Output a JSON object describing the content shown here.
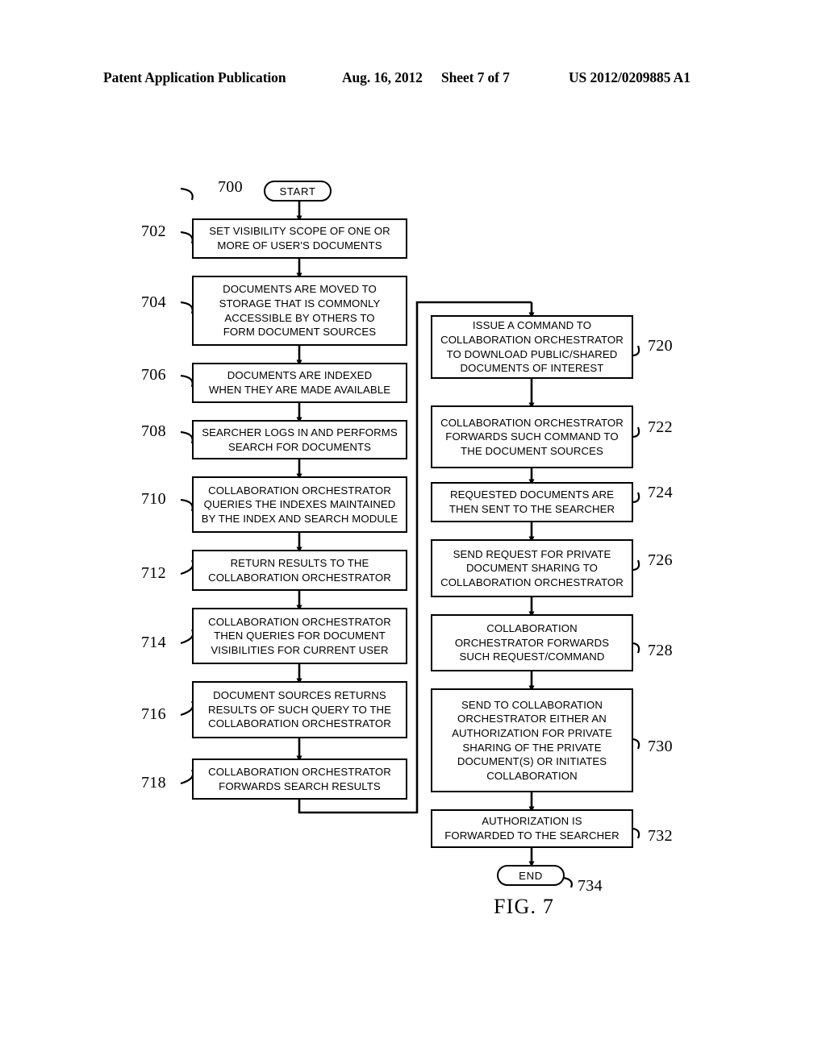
{
  "header": {
    "publication": "Patent Application Publication",
    "date": "Aug. 16, 2012",
    "sheet": "Sheet 7 of 7",
    "patent_number": "US 2012/0209885 A1"
  },
  "figure": {
    "caption": "FIG. 7",
    "diagram_type": "flowchart",
    "line_color": "#000000",
    "background_color": "#ffffff"
  },
  "flowchart": {
    "start": {
      "ref": "700",
      "label": "START"
    },
    "end": {
      "ref": "734",
      "label": "END"
    },
    "left_column": [
      {
        "ref": "702",
        "text": "SET VISIBILITY SCOPE OF ONE OR\nMORE OF USER'S DOCUMENTS"
      },
      {
        "ref": "704",
        "text": "DOCUMENTS ARE MOVED TO\nSTORAGE THAT IS COMMONLY\nACCESSIBLE BY OTHERS TO\nFORM DOCUMENT SOURCES"
      },
      {
        "ref": "706",
        "text": "DOCUMENTS ARE INDEXED\nWHEN THEY ARE MADE AVAILABLE"
      },
      {
        "ref": "708",
        "text": "SEARCHER LOGS IN AND PERFORMS\nSEARCH FOR DOCUMENTS"
      },
      {
        "ref": "710",
        "text": "COLLABORATION ORCHESTRATOR\nQUERIES THE INDEXES MAINTAINED\nBY THE INDEX AND SEARCH MODULE"
      },
      {
        "ref": "712",
        "text": "RETURN RESULTS TO THE\nCOLLABORATION ORCHESTRATOR"
      },
      {
        "ref": "714",
        "text": "COLLABORATION ORCHESTRATOR\nTHEN QUERIES FOR DOCUMENT\nVISIBILITIES FOR CURRENT USER"
      },
      {
        "ref": "716",
        "text": "DOCUMENT SOURCES RETURNS\nRESULTS OF SUCH QUERY TO THE\nCOLLABORATION ORCHESTRATOR"
      },
      {
        "ref": "718",
        "text": "COLLABORATION ORCHESTRATOR\nFORWARDS SEARCH RESULTS"
      }
    ],
    "right_column": [
      {
        "ref": "720",
        "text": "ISSUE A COMMAND TO\nCOLLABORATION ORCHESTRATOR\nTO DOWNLOAD PUBLIC/SHARED\nDOCUMENTS OF INTEREST"
      },
      {
        "ref": "722",
        "text": "COLLABORATION ORCHESTRATOR\nFORWARDS SUCH COMMAND TO\nTHE DOCUMENT SOURCES"
      },
      {
        "ref": "724",
        "text": "REQUESTED DOCUMENTS ARE\nTHEN SENT TO THE SEARCHER"
      },
      {
        "ref": "726",
        "text": "SEND REQUEST FOR PRIVATE\nDOCUMENT SHARING TO\nCOLLABORATION ORCHESTRATOR"
      },
      {
        "ref": "728",
        "text": "COLLABORATION\nORCHESTRATOR FORWARDS\nSUCH REQUEST/COMMAND"
      },
      {
        "ref": "730",
        "text": "SEND TO COLLABORATION\nORCHESTRATOR EITHER AN\nAUTHORIZATION FOR PRIVATE\nSHARING OF THE PRIVATE\nDOCUMENT(S) OR INITIATES\nCOLLABORATION"
      },
      {
        "ref": "732",
        "text": "AUTHORIZATION IS\nFORWARDED TO THE SEARCHER"
      }
    ]
  }
}
